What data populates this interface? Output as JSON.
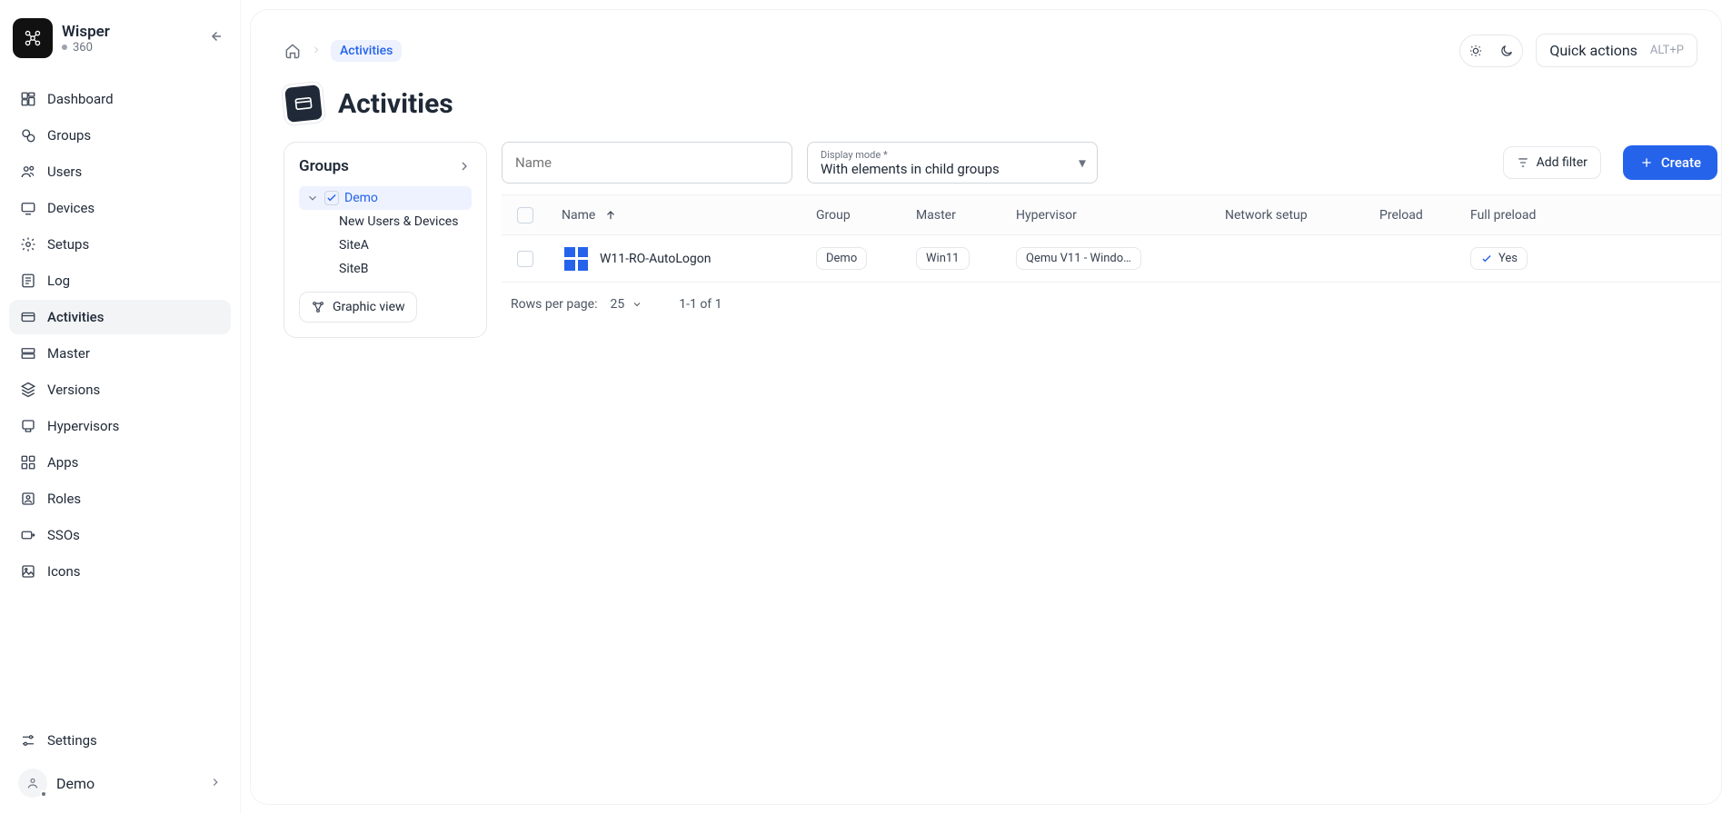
{
  "brand": {
    "name": "Wisper",
    "sub": "360"
  },
  "nav": [
    {
      "key": "dashboard",
      "label": "Dashboard"
    },
    {
      "key": "groups",
      "label": "Groups"
    },
    {
      "key": "users",
      "label": "Users"
    },
    {
      "key": "devices",
      "label": "Devices"
    },
    {
      "key": "setups",
      "label": "Setups"
    },
    {
      "key": "log",
      "label": "Log"
    },
    {
      "key": "activities",
      "label": "Activities"
    },
    {
      "key": "master",
      "label": "Master"
    },
    {
      "key": "versions",
      "label": "Versions"
    },
    {
      "key": "hypervisors",
      "label": "Hypervisors"
    },
    {
      "key": "apps",
      "label": "Apps"
    },
    {
      "key": "roles",
      "label": "Roles"
    },
    {
      "key": "ssos",
      "label": "SSOs"
    },
    {
      "key": "icons",
      "label": "Icons"
    }
  ],
  "nav_active": "activities",
  "settings_label": "Settings",
  "user": {
    "name": "Demo"
  },
  "breadcrumb": {
    "current": "Activities"
  },
  "page": {
    "title": "Activities"
  },
  "quick_actions": {
    "label": "Quick actions",
    "shortcut": "ALT+P"
  },
  "groups_panel": {
    "title": "Groups",
    "selected": "Demo",
    "children": [
      "New Users & Devices",
      "SiteA",
      "SiteB"
    ],
    "graphic_btn": "Graphic view"
  },
  "filters": {
    "name_placeholder": "Name",
    "display_mode_label": "Display mode *",
    "display_mode_value": "With elements in child groups",
    "add_filter": "Add filter",
    "create": "Create"
  },
  "table": {
    "columns": {
      "name": "Name",
      "group": "Group",
      "master": "Master",
      "hypervisor": "Hypervisor",
      "network": "Network setup",
      "preload": "Preload",
      "full_preload": "Full preload"
    },
    "rows": [
      {
        "name": "W11-RO-AutoLogon",
        "group": "Demo",
        "master": "Win11",
        "hypervisor": "Qemu V11 - Windo…",
        "network": "",
        "preload": "",
        "full_preload": "Yes"
      }
    ],
    "footer": {
      "rows_per_page_label": "Rows per page:",
      "rows_per_page_value": "25",
      "range": "1-1 of 1"
    }
  }
}
